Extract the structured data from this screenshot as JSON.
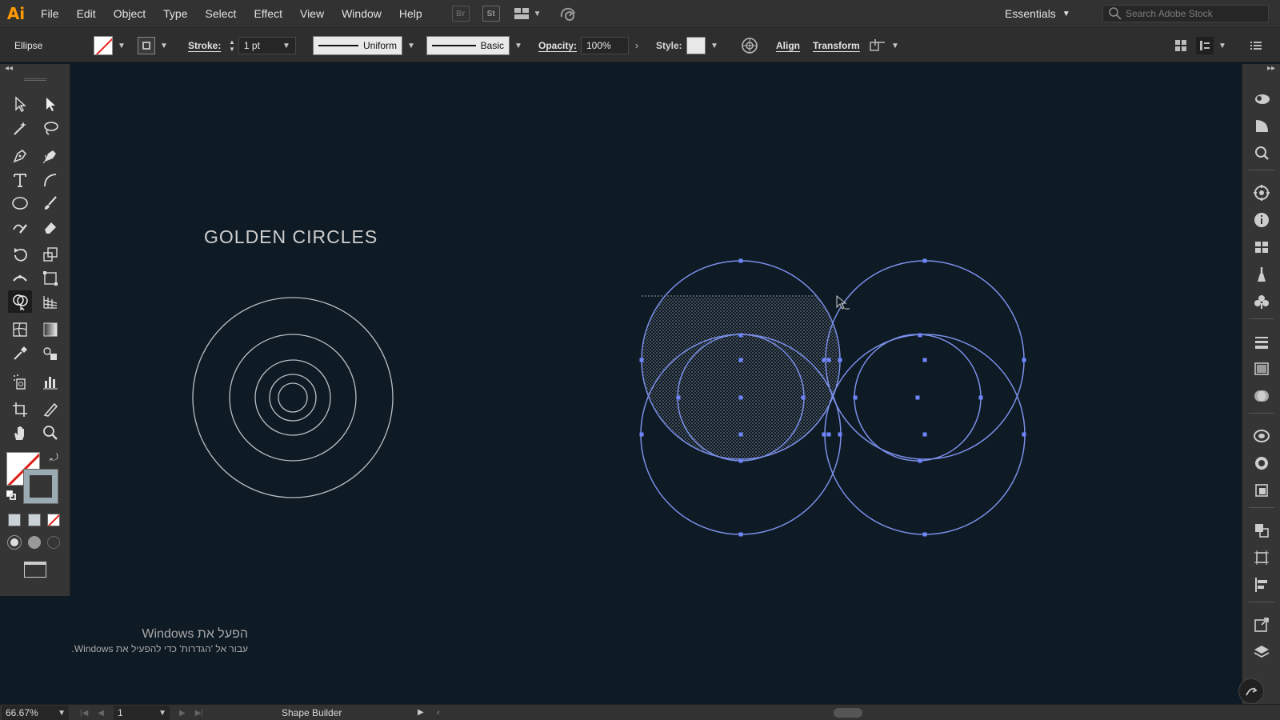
{
  "app": {
    "logo": "Ai"
  },
  "menu": [
    "File",
    "Edit",
    "Object",
    "Type",
    "Select",
    "Effect",
    "View",
    "Window",
    "Help"
  ],
  "menu_icons": {
    "bridge": "Br",
    "stock": "St"
  },
  "workspace": {
    "label": "Essentials"
  },
  "search": {
    "placeholder": "Search Adobe Stock"
  },
  "control": {
    "object_type": "Ellipse",
    "stroke_label": "Stroke:",
    "stroke_weight": "1 pt",
    "variable_width": "Uniform",
    "brush": "Basic",
    "opacity_label": "Opacity:",
    "opacity_value": "100%",
    "style_label": "Style:",
    "align": "Align",
    "transform": "Transform"
  },
  "canvas": {
    "title": "GOLDEN CIRCLES",
    "stroke_color": "#7b8fe8",
    "guide_color": "#b9bec4"
  },
  "activation": {
    "line1": "הפעל את Windows",
    "line2": "עבור אל 'הגדרות' כדי להפעיל את Windows."
  },
  "status": {
    "zoom": "66.67%",
    "artboard": "1",
    "tool": "Shape Builder"
  },
  "colors": {
    "accent": "#ff9a00",
    "selection": "#6f86ff",
    "canvas_bg": "#0e1a24"
  }
}
